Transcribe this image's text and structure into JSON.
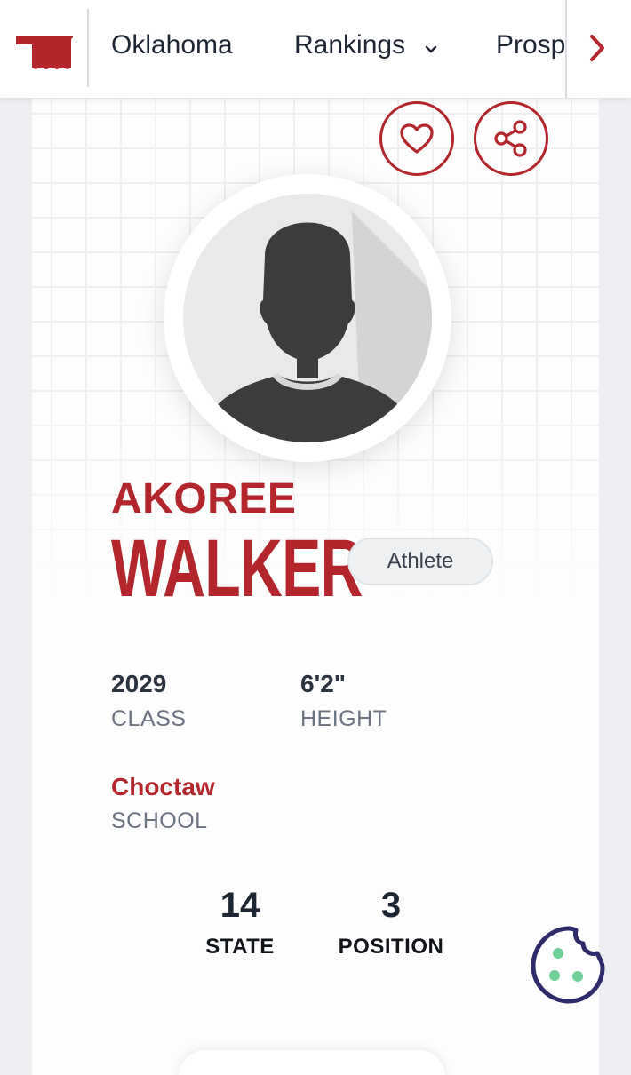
{
  "nav": {
    "state_label": "Oklahoma",
    "rankings_label": "Rankings",
    "prospects_label": "Prosp",
    "icons": {
      "logo": "oklahoma-state-shape-icon",
      "rankings_dropdown": "chevron-down-icon",
      "scroll_right": "chevron-right-icon"
    }
  },
  "profile": {
    "first_name": "AKOREE",
    "last_name": "WALKER",
    "position_badge": "Athlete",
    "avatar": "default-player-silhouette"
  },
  "stats": {
    "class_value": "2029",
    "class_label": "CLASS",
    "height_value": "6'2\"",
    "height_label": "HEIGHT",
    "school_value": "Choctaw",
    "school_label": "SCHOOL"
  },
  "rankings": {
    "state_rank": "14",
    "state_label": "STATE",
    "position_rank": "3",
    "position_label": "POSITION"
  },
  "actions": {
    "favorite": "heart-icon",
    "share": "share-icon",
    "cookie_settings": "cookie-icon"
  },
  "colors": {
    "brand_red": "#b3262b",
    "cookie_navy": "#2e2a6b",
    "cookie_dots": "#6fcf97"
  }
}
